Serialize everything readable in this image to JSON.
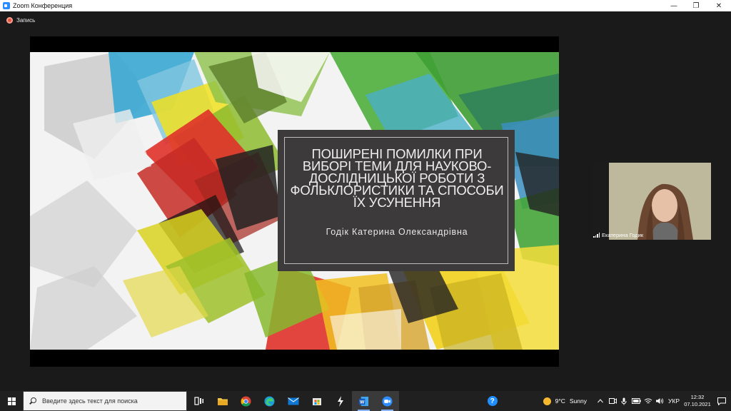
{
  "window": {
    "title": "Zoom Конференция",
    "minimize_glyph": "—",
    "restore_glyph": "❐",
    "close_glyph": "✕"
  },
  "recording": {
    "label": "Запись"
  },
  "slide": {
    "title": "Поширені помилки при виборі теми для науково-дослідницької роботи з фольклористики та способи їх усунення",
    "subtitle": "Годік Катерина Олександрівна",
    "colors": {
      "box": "#3c3a3b",
      "red": "#e0312a",
      "green": "#4fae3c",
      "yellow": "#f2d01e",
      "blue": "#3aa0d0"
    }
  },
  "participant": {
    "name": "Екатерина Годик"
  },
  "taskbar": {
    "search_placeholder": "Введите здесь текст для поиска",
    "apps": [
      "task-view-icon",
      "file-explorer-icon",
      "chrome-icon",
      "edge-icon",
      "mail-icon",
      "store-icon",
      "python-icon",
      "word-icon",
      "zoom-icon"
    ],
    "help_glyph": "?",
    "weather": {
      "temp": "9°C",
      "condition": "Sunny"
    },
    "language": "УКР",
    "time": "12:32",
    "date": "07.10.2021"
  }
}
